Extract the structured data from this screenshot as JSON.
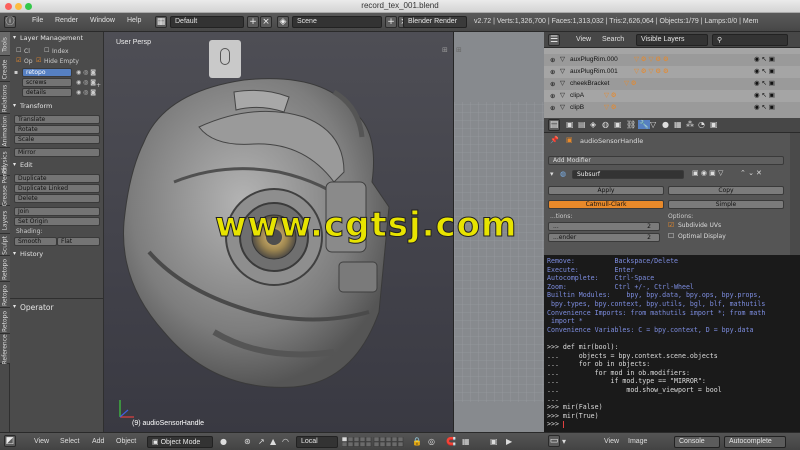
{
  "window": {
    "title": "record_tex_001.blend"
  },
  "info_header": {
    "menu": [
      "File",
      "Render",
      "Window",
      "Help"
    ],
    "layout": "Default",
    "scene": "Scene",
    "engine": "Blender Render",
    "stats": "v2.72 | Verts:1,326,700 | Faces:1,313,032 | Tris:2,626,064 | Objects:1/79 | Lamps:0/0 | Mem"
  },
  "tool_tabs": [
    "Tools",
    "Create",
    "Relations",
    "Animation",
    "Physics",
    "Grease Pencil",
    "Layers",
    "Sculpt",
    "Retopo",
    "Retopo",
    "Retopo",
    "Reference"
  ],
  "tool_shelf": {
    "layer_management": {
      "title": "Layer Management",
      "cl_label": "Cl",
      "index_label": "Index",
      "op_label": "Op",
      "hide_empty_label": "Hide Empty",
      "layers": [
        "retopo",
        "screws",
        "details"
      ]
    },
    "transform": {
      "title": "Transform",
      "buttons": [
        "Translate",
        "Rotate",
        "Scale"
      ],
      "mirror": "Mirror"
    },
    "edit": {
      "title": "Edit",
      "buttons": [
        "Duplicate",
        "Duplicate Linked",
        "Delete"
      ],
      "join": "Join",
      "set_origin": "Set Origin",
      "shading_label": "Shading:",
      "smooth": "Smooth",
      "flat": "Flat"
    },
    "history": {
      "title": "History"
    },
    "operator": {
      "title": "Operator"
    }
  },
  "viewport": {
    "label": "User Persp",
    "object_label": "(9) audioSensorHandle"
  },
  "watermark": "www.cgtsj.com",
  "outliner": {
    "view": "View",
    "search": "Search",
    "filter": "Visible Layers",
    "rows": [
      {
        "name": "auxPlugRim.000",
        "selected": false
      },
      {
        "name": "auxPlugRim.001",
        "selected": false
      },
      {
        "name": "cheekBracket",
        "selected": false
      },
      {
        "name": "clipA",
        "selected": false
      },
      {
        "name": "clipB",
        "selected": false
      }
    ]
  },
  "properties": {
    "object_name": "audioSensorHandle",
    "add_modifier": "Add Modifier",
    "modifier_name": "Subsurf",
    "apply": "Apply",
    "copy": "Copy",
    "catmull": "Catmull-Clark",
    "simple": "Simple",
    "subdivisions_label": "...tions:",
    "view_label": "...",
    "view_value": "2",
    "render_label": "...ender",
    "render_value": "2",
    "options_label": "Options:",
    "subdivide_uvs": "Subdivide UVs",
    "optimal_display": "Optimal Display"
  },
  "console": {
    "lines": [
      {
        "text": "Remove:          Backspace/Delete",
        "color": "#7d8de0"
      },
      {
        "text": "Execute:         Enter",
        "color": "#7d8de0"
      },
      {
        "text": "Autocomplete:    Ctrl-Space",
        "color": "#7d8de0"
      },
      {
        "text": "Zoom:            Ctrl +/-, Ctrl-Wheel",
        "color": "#7d8de0"
      },
      {
        "text": "Builtin Modules:    bpy, bpy.data, bpy.ops, bpy.props,",
        "color": "#7d8de0"
      },
      {
        "text": " bpy.types, bpy.context, bpy.utils, bgl, blf, mathutils",
        "color": "#7d8de0"
      },
      {
        "text": "Convenience Imports: from mathutils import *; from math",
        "color": "#7d8de0"
      },
      {
        "text": " import *",
        "color": "#7d8de0"
      },
      {
        "text": "Convenience Variables: C = bpy.context, D = bpy.data",
        "color": "#7d8de0"
      },
      {
        "text": "",
        "color": "#ddd"
      },
      {
        "text": ">>> def mir(bool):",
        "color": "#ddd"
      },
      {
        "text": "...     objects = bpy.context.scene.objects",
        "color": "#ddd"
      },
      {
        "text": "...     for ob in objects:",
        "color": "#ddd"
      },
      {
        "text": "...         for mod in ob.modifiers:",
        "color": "#ddd"
      },
      {
        "text": "...             if mod.type == \"MIRROR\":",
        "color": "#ddd"
      },
      {
        "text": "...                 mod.show_viewport = bool",
        "color": "#ddd"
      },
      {
        "text": "...",
        "color": "#ddd"
      },
      {
        "text": ">>> mir(False)",
        "color": "#ddd"
      },
      {
        "text": ">>> mir(True)",
        "color": "#ddd"
      },
      {
        "text": ">>> ",
        "color": "#ddd"
      }
    ]
  },
  "footer_3d": {
    "view": "View",
    "select": "Select",
    "add": "Add",
    "object": "Object",
    "mode": "Object Mode",
    "orientation": "Local"
  },
  "footer_console": {
    "view": "View",
    "image": "Image",
    "console": "Console",
    "autocomplete": "Autocomplete"
  },
  "colors": {
    "accent_orange": "#e8892a",
    "selection_blue": "#5680c2",
    "watermark_yellow": "#e8e400"
  }
}
